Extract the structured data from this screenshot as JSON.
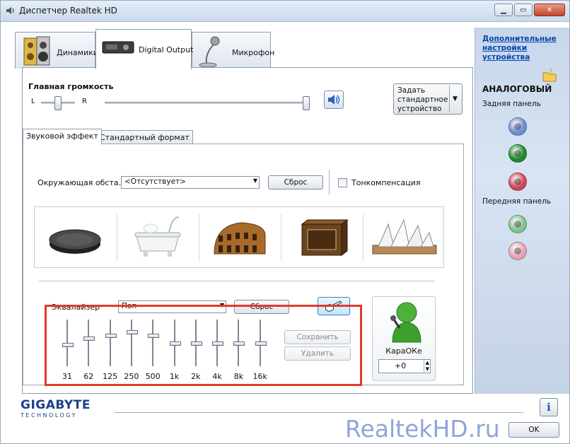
{
  "window": {
    "title": "Диспетчер Realtek HD"
  },
  "tabs": [
    {
      "label": "Динамики"
    },
    {
      "label": "Digital Output"
    },
    {
      "label": "Микрофон"
    }
  ],
  "volume": {
    "label": "Главная громкость",
    "left": "L",
    "right": "R",
    "balance_value": 0.5,
    "volume_value": 1.0
  },
  "default_device": {
    "label": "Задать стандартное устройство"
  },
  "subtabs": [
    {
      "label": "Звуковой эффект"
    },
    {
      "label": "Стандартный формат"
    }
  ],
  "environment": {
    "label": "Окружающая обста...",
    "selected": "<Отсутствует>",
    "reset_label": "Сброс",
    "loudness_label": "Тонкомпенсация",
    "loudness_checked": false,
    "presets": [
      {
        "icon": "sewer-disc-icon"
      },
      {
        "icon": "bathtub-icon"
      },
      {
        "icon": "colosseum-icon"
      },
      {
        "icon": "wooden-box-icon"
      },
      {
        "icon": "opera-house-icon"
      }
    ]
  },
  "equalizer": {
    "label": "Эквалайзер",
    "selected": "Поп",
    "reset_label": "Сброс",
    "save_label": "Сохранить",
    "delete_label": "Удалить",
    "bands": [
      {
        "freq": "31",
        "level": 0.55
      },
      {
        "freq": "62",
        "level": 0.4
      },
      {
        "freq": "125",
        "level": 0.33
      },
      {
        "freq": "250",
        "level": 0.25
      },
      {
        "freq": "500",
        "level": 0.33
      },
      {
        "freq": "1k",
        "level": 0.52
      },
      {
        "freq": "2k",
        "level": 0.52
      },
      {
        "freq": "4k",
        "level": 0.52
      },
      {
        "freq": "8k",
        "level": 0.52
      },
      {
        "freq": "16k",
        "level": 0.52
      }
    ]
  },
  "karaoke": {
    "label": "КараОКе",
    "value": "+0"
  },
  "side": {
    "link": "Дополнительные настройки устройства",
    "analog_title": "АНАЛОГОВЫЙ",
    "rear_label": "Задняя панель",
    "front_label": "Передняя панель",
    "rear_jacks": [
      {
        "color": "#6e8fd2"
      },
      {
        "color": "#1f8a2b"
      },
      {
        "color": "#d0455b"
      }
    ],
    "front_jacks": [
      {
        "color": "#7fc48e"
      },
      {
        "color": "#e6a3b3"
      }
    ]
  },
  "footer": {
    "brand": "GIGABYTE",
    "brand_sub": "TECHNOLOGY",
    "ok_label": "OK",
    "watermark": "RealtekHD.ru",
    "info_icon": "info-icon"
  }
}
